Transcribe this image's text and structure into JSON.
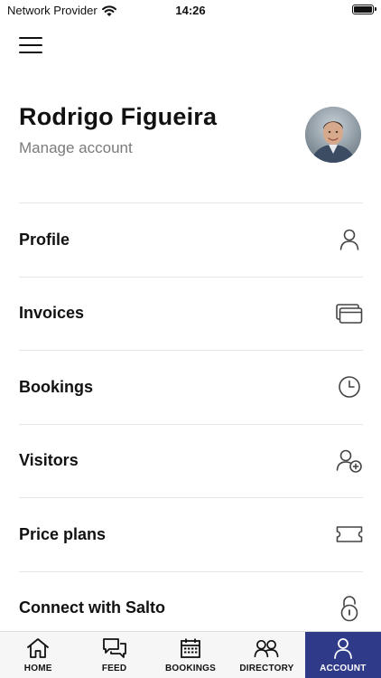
{
  "status_bar": {
    "carrier": "Network Provider",
    "time": "14:26"
  },
  "header": {
    "user_name": "Rodrigo Figueira",
    "manage_label": "Manage account"
  },
  "menu": {
    "items": [
      {
        "label": "Profile",
        "icon": "person-icon"
      },
      {
        "label": "Invoices",
        "icon": "cards-icon"
      },
      {
        "label": "Bookings",
        "icon": "clock-icon"
      },
      {
        "label": "Visitors",
        "icon": "add-person-icon"
      },
      {
        "label": "Price plans",
        "icon": "ticket-icon"
      },
      {
        "label": "Connect with Salto",
        "icon": "lock-icon"
      }
    ]
  },
  "tab_bar": {
    "tabs": [
      {
        "label": "HOME",
        "icon": "home-icon"
      },
      {
        "label": "FEED",
        "icon": "chat-icon"
      },
      {
        "label": "BOOKINGS",
        "icon": "calendar-icon"
      },
      {
        "label": "DIRECTORY",
        "icon": "people-icon"
      },
      {
        "label": "ACCOUNT",
        "icon": "person-icon"
      }
    ],
    "active": "ACCOUNT"
  },
  "colors": {
    "accent": "#2f3a88",
    "muted_text": "#7b7b7b",
    "divider": "#e6e6e6"
  }
}
